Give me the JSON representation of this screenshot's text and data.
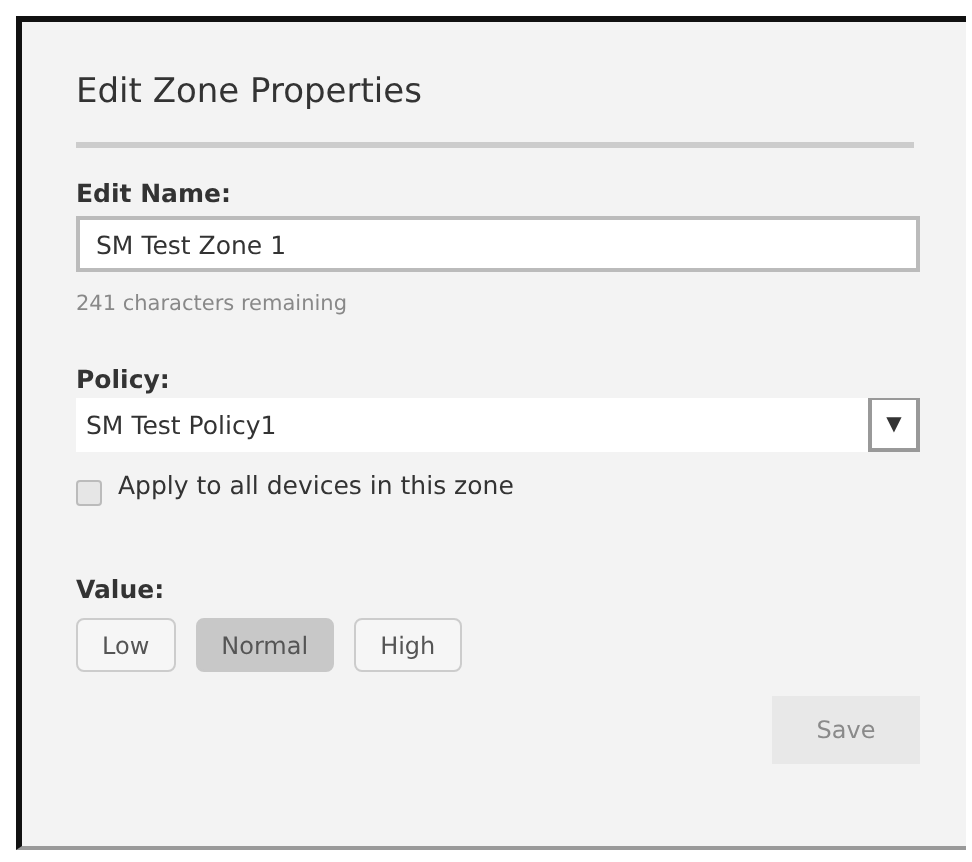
{
  "dialog": {
    "title": "Edit Zone Properties"
  },
  "name_field": {
    "label": "Edit Name:",
    "value": "SM Test Zone 1",
    "helper": "241 characters remaining"
  },
  "policy": {
    "label": "Policy:",
    "value": "SM Test Policy1",
    "dropdown_icon": "▼"
  },
  "apply_all": {
    "label": "Apply to all devices in this zone",
    "checked": false
  },
  "value": {
    "label": "Value:",
    "options": [
      {
        "label": "Low",
        "selected": false
      },
      {
        "label": "Normal",
        "selected": true
      },
      {
        "label": "High",
        "selected": false
      }
    ]
  },
  "save": {
    "label": "Save",
    "disabled": true
  }
}
